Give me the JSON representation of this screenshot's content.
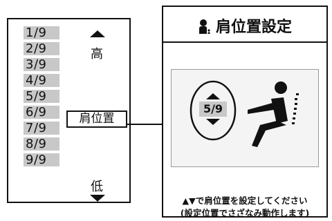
{
  "scale": {
    "items": [
      "1/9",
      "2/9",
      "3/9",
      "4/9",
      "5/9",
      "6/9",
      "7/9",
      "8/9",
      "9/9"
    ],
    "high_label": "高",
    "low_label": "低",
    "shoulder_tag": "肩位置"
  },
  "screen": {
    "title": "肩位置設定",
    "selected_value": "5/9",
    "instruction_line1": "▲▼で肩位置を設定してください",
    "instruction_line2": "(設定位置でさざなみ動作します)"
  },
  "colors": {
    "item_bg": "#c8c8c8",
    "line": "#111111",
    "display_bg": "#f4f4f4"
  }
}
